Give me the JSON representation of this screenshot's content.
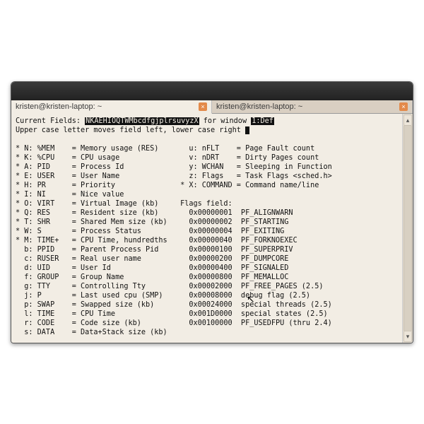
{
  "tabs": [
    {
      "title": "kristen@kristen-laptop: ~"
    },
    {
      "title": "kristen@kristen-laptop: ~"
    }
  ],
  "hdr": {
    "cf_label": "Current Fields: ",
    "cf_value": "NKAEHIOQTWMbcdfgjplrsuvyzX",
    "cf_mid": " for window ",
    "cf_win": "1:Def",
    "instr": "Upper case letter moves field left, lower case right "
  },
  "left": [
    {
      "m": "*",
      "k": "N",
      "f": "%MEM",
      "d": "Memory usage (RES)"
    },
    {
      "m": "*",
      "k": "K",
      "f": "%CPU",
      "d": "CPU usage"
    },
    {
      "m": "*",
      "k": "A",
      "f": "PID",
      "d": "Process Id"
    },
    {
      "m": "*",
      "k": "E",
      "f": "USER",
      "d": "User Name"
    },
    {
      "m": "*",
      "k": "H",
      "f": "PR",
      "d": "Priority"
    },
    {
      "m": "*",
      "k": "I",
      "f": "NI",
      "d": "Nice value"
    },
    {
      "m": "*",
      "k": "O",
      "f": "VIRT",
      "d": "Virtual Image (kb)"
    },
    {
      "m": "*",
      "k": "Q",
      "f": "RES",
      "d": "Resident size (kb)"
    },
    {
      "m": "*",
      "k": "T",
      "f": "SHR",
      "d": "Shared Mem size (kb)"
    },
    {
      "m": "*",
      "k": "W",
      "f": "S",
      "d": "Process Status"
    },
    {
      "m": "*",
      "k": "M",
      "f": "TIME+",
      "d": "CPU Time, hundredths"
    },
    {
      "m": " ",
      "k": "b",
      "f": "PPID",
      "d": "Parent Process Pid"
    },
    {
      "m": " ",
      "k": "c",
      "f": "RUSER",
      "d": "Real user name"
    },
    {
      "m": " ",
      "k": "d",
      "f": "UID",
      "d": "User Id"
    },
    {
      "m": " ",
      "k": "f",
      "f": "GROUP",
      "d": "Group Name"
    },
    {
      "m": " ",
      "k": "g",
      "f": "TTY",
      "d": "Controlling Tty"
    },
    {
      "m": " ",
      "k": "j",
      "f": "P",
      "d": "Last used cpu (SMP)"
    },
    {
      "m": " ",
      "k": "p",
      "f": "SWAP",
      "d": "Swapped size (kb)"
    },
    {
      "m": " ",
      "k": "l",
      "f": "TIME",
      "d": "CPU Time"
    },
    {
      "m": " ",
      "k": "r",
      "f": "CODE",
      "d": "Code size (kb)"
    },
    {
      "m": " ",
      "k": "s",
      "f": "DATA",
      "d": "Data+Stack size (kb)"
    }
  ],
  "right_top": [
    {
      "m": " ",
      "k": "u",
      "f": "nFLT",
      "d": "Page Fault count"
    },
    {
      "m": " ",
      "k": "v",
      "f": "nDRT",
      "d": "Dirty Pages count"
    },
    {
      "m": " ",
      "k": "y",
      "f": "WCHAN",
      "d": "Sleeping in Function"
    },
    {
      "m": " ",
      "k": "z",
      "f": "Flags",
      "d": "Task Flags <sched.h>"
    },
    {
      "m": "*",
      "k": "X",
      "f": "COMMAND",
      "d": "Command name/line"
    }
  ],
  "flags_label": "Flags field:",
  "flags": [
    {
      "h": "0x00000001",
      "n": "PF_ALIGNWARN"
    },
    {
      "h": "0x00000002",
      "n": "PF_STARTING"
    },
    {
      "h": "0x00000004",
      "n": "PF_EXITING"
    },
    {
      "h": "0x00000040",
      "n": "PF_FORKNOEXEC"
    },
    {
      "h": "0x00000100",
      "n": "PF_SUPERPRIV"
    },
    {
      "h": "0x00000200",
      "n": "PF_DUMPCORE"
    },
    {
      "h": "0x00000400",
      "n": "PF_SIGNALED"
    },
    {
      "h": "0x00000800",
      "n": "PF_MEMALLOC"
    },
    {
      "h": "0x00002000",
      "n": "PF_FREE_PAGES (2.5)"
    },
    {
      "h": "0x00008000",
      "n": "debug flag (2.5)"
    },
    {
      "h": "0x00024000",
      "n": "special threads (2.5)"
    },
    {
      "h": "0x001D0000",
      "n": "special states (2.5)"
    },
    {
      "h": "0x00100000",
      "n": "PF_USEDFPU (thru 2.4)"
    }
  ]
}
